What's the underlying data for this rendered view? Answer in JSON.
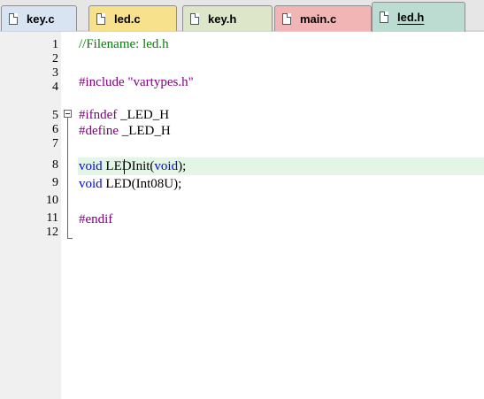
{
  "tabs": [
    {
      "label": "key.c",
      "bg": "#d9e4f3"
    },
    {
      "label": "led.c",
      "bg": "#f7e18c"
    },
    {
      "label": "key.h",
      "bg": "#dde6c9"
    },
    {
      "label": "main.c",
      "bg": "#f2b5b5"
    },
    {
      "label": "led.h",
      "bg": "#bcdcd1",
      "active": true
    }
  ],
  "line_numbers": [
    "1",
    "2",
    "3",
    "4",
    "5",
    "6",
    "7",
    "8",
    "9",
    "10",
    "11",
    "12"
  ],
  "code": {
    "line1": {
      "comment": "//Filename: led.h"
    },
    "line3": {
      "directive": "#include",
      "string": "\"vartypes.h\""
    },
    "line5": {
      "directive": "#ifndef",
      "ident": "_LED_H"
    },
    "line6": {
      "directive": "#define",
      "ident": "_LED_H"
    },
    "line8": {
      "kw": "void",
      "func": "LEDInit",
      "open": "(",
      "arg": "void",
      "close": ");"
    },
    "line9": {
      "kw": "void",
      "func": "LED",
      "open": "(",
      "arg": "Int08U",
      "close": ");"
    },
    "line11": {
      "directive": "#endif"
    }
  },
  "colors": {
    "comment": "#008000",
    "preprocessor": "#800080",
    "keyword": "#0000ff",
    "current_line": "#e3f5e5",
    "gutter": "#f0f0f0"
  },
  "current_line": 8
}
